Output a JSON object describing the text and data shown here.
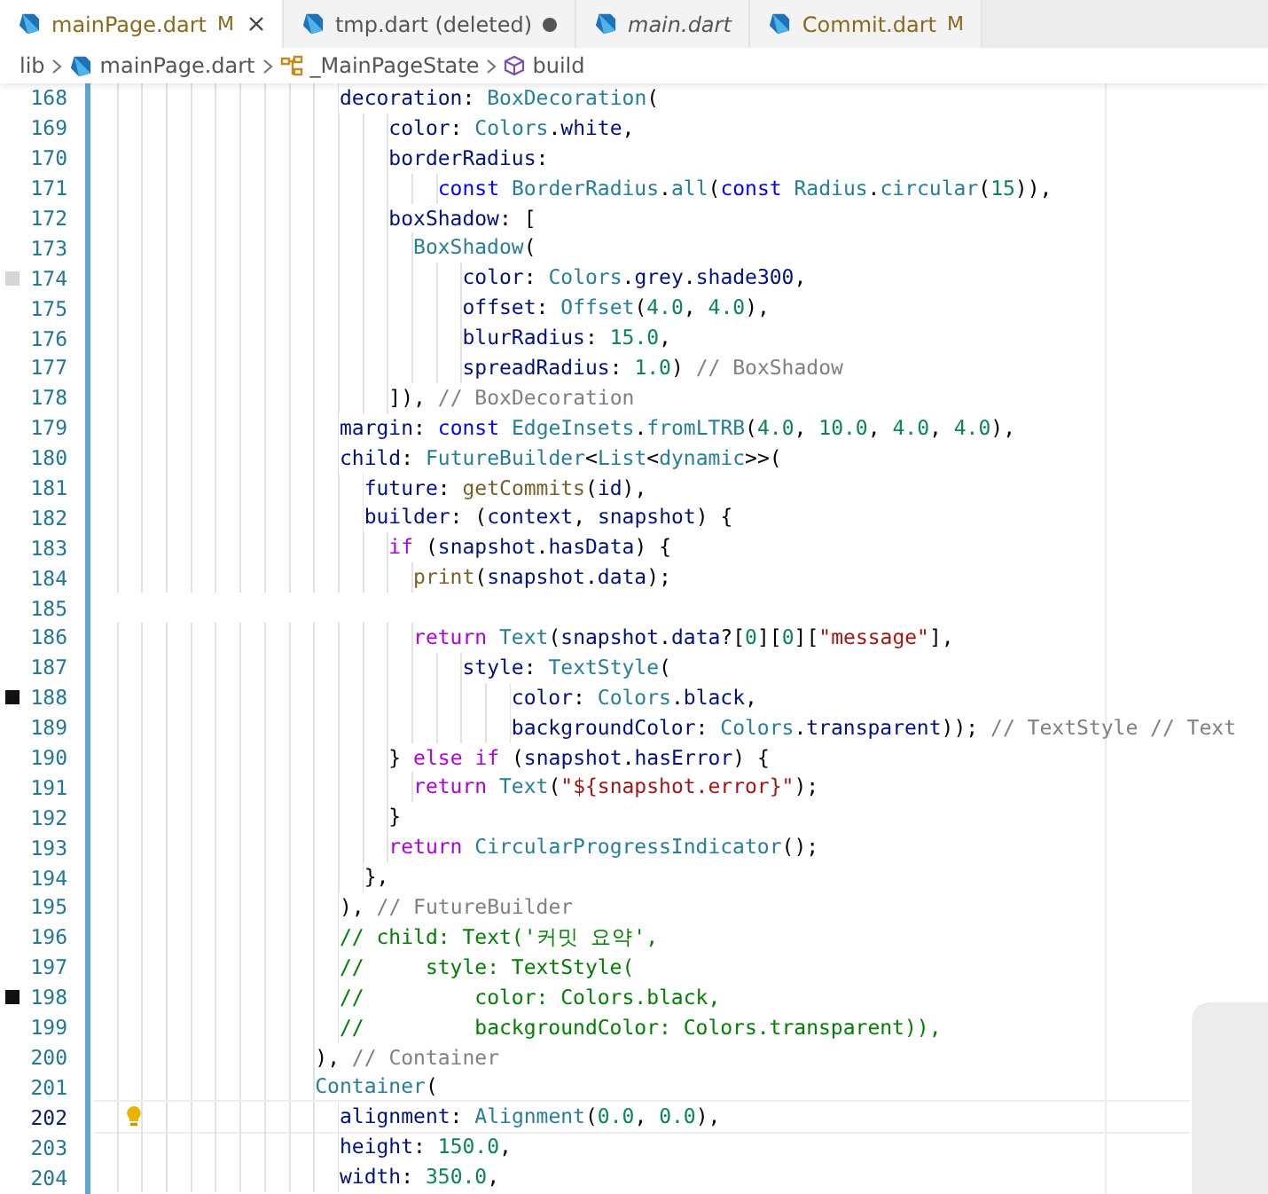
{
  "tabs": [
    {
      "label": "mainPage.dart",
      "badge": "M",
      "modified": true,
      "preview": false,
      "dirty": false,
      "selected": true
    },
    {
      "label": "tmp.dart (deleted)",
      "modified": false,
      "preview": false,
      "dirty": true,
      "selected": false
    },
    {
      "label": "main.dart",
      "modified": false,
      "preview": true,
      "dirty": false,
      "selected": false
    },
    {
      "label": "Commit.dart",
      "badge": "M",
      "modified": true,
      "preview": false,
      "dirty": false,
      "selected": false
    }
  ],
  "breadcrumb": [
    {
      "label": "lib",
      "kind": "folder"
    },
    {
      "label": "mainPage.dart",
      "kind": "file"
    },
    {
      "label": "_MainPageState",
      "kind": "class"
    },
    {
      "label": "build",
      "kind": "method"
    }
  ],
  "lines": [
    {
      "number": "168",
      "current": false,
      "code": "                    decoration: BoxDecoration("
    },
    {
      "number": "169",
      "current": false,
      "code": "                        color: Colors.white,"
    },
    {
      "number": "170",
      "current": false,
      "code": "                        borderRadius:"
    },
    {
      "number": "171",
      "current": false,
      "code": "                            const BorderRadius.all(const Radius.circular(15)),"
    },
    {
      "number": "172",
      "current": false,
      "code": "                        boxShadow: ["
    },
    {
      "number": "173",
      "current": false,
      "code": "                          BoxShadow("
    },
    {
      "number": "174",
      "current": false,
      "color": "#d6d6d6",
      "code": "                              color: Colors.grey.shade300,"
    },
    {
      "number": "175",
      "current": false,
      "code": "                              offset: Offset(4.0, 4.0),"
    },
    {
      "number": "176",
      "current": false,
      "code": "                              blurRadius: 15.0,"
    },
    {
      "number": "177",
      "current": false,
      "code": "                              spreadRadius: 1.0)",
      "label": "// BoxShadow"
    },
    {
      "number": "178",
      "current": false,
      "code": "                        ]),",
      "label": "// BoxDecoration"
    },
    {
      "number": "179",
      "current": false,
      "code": "                    margin: const EdgeInsets.fromLTRB(4.0, 10.0, 4.0, 4.0),"
    },
    {
      "number": "180",
      "current": false,
      "code": "                    child: FutureBuilder<List<dynamic>>("
    },
    {
      "number": "181",
      "current": false,
      "code": "                      future: getCommits(id),"
    },
    {
      "number": "182",
      "current": false,
      "code": "                      builder: (context, snapshot) {"
    },
    {
      "number": "183",
      "current": false,
      "code": "                        if (snapshot.hasData) {"
    },
    {
      "number": "184",
      "current": false,
      "code": "                          print(snapshot.data);"
    },
    {
      "number": "185",
      "current": false
    },
    {
      "number": "186",
      "current": false,
      "code": "                          return Text(snapshot.data?[0][0][\"message\"],"
    },
    {
      "number": "187",
      "current": false,
      "code": "                              style: TextStyle("
    },
    {
      "number": "188",
      "current": false,
      "color": "#111111",
      "code": "                                  color: Colors.black,"
    },
    {
      "number": "189",
      "current": false,
      "code": "                                  backgroundColor: Colors.transparent));",
      "label": "// TextStyle // Text"
    },
    {
      "number": "190",
      "current": false,
      "code": "                        } else if (snapshot.hasError) {"
    },
    {
      "number": "191",
      "current": false,
      "code": "                          return Text(\"${snapshot.error}\");"
    },
    {
      "number": "192",
      "current": false,
      "code": "                        }"
    },
    {
      "number": "193",
      "current": false,
      "code": "                        return CircularProgressIndicator();"
    },
    {
      "number": "194",
      "current": false,
      "code": "                      },"
    },
    {
      "number": "195",
      "current": false,
      "code": "                    ),",
      "label": "// FutureBuilder"
    },
    {
      "number": "196",
      "current": false,
      "code": "                    // child: Text('커밋 요약',"
    },
    {
      "number": "197",
      "current": false,
      "code": "                    //     style: TextStyle("
    },
    {
      "number": "198",
      "current": false,
      "color": "#111111",
      "code": "                    //         color: Colors.black,"
    },
    {
      "number": "199",
      "current": false,
      "code": "                    //         backgroundColor: Colors.transparent)),"
    },
    {
      "number": "200",
      "current": false,
      "code": "                  ),",
      "label": "// Container"
    },
    {
      "number": "201",
      "current": false,
      "code": "                  Container("
    },
    {
      "number": "202",
      "current": true,
      "hint": true,
      "code": "                    alignment: Alignment(0.0, 0.0),"
    },
    {
      "number": "203",
      "current": false,
      "code": "                    height: 150.0,"
    },
    {
      "number": "204",
      "current": false,
      "code": "                    width: 350.0,"
    }
  ]
}
